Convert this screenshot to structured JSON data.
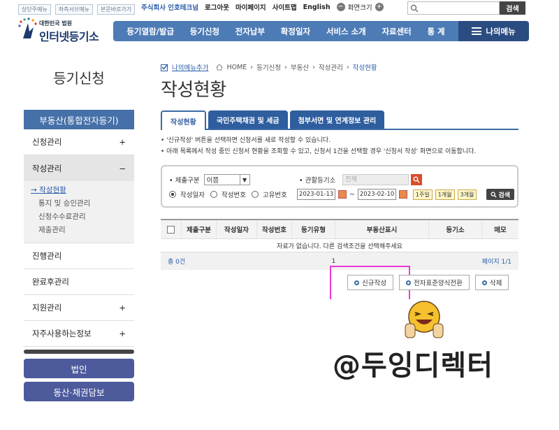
{
  "util": {
    "links": [
      "상단주메뉴",
      "좌측서브메뉴",
      "본문바로가기"
    ],
    "company": "주식회사 인호테크넘",
    "logout": "로그아웃",
    "mypage": "마이페이지",
    "sitemap": "사이트맵",
    "english": "English",
    "zoom_label": "화면크기",
    "zoom_out": "−",
    "zoom_in": "+",
    "search_button": "검색",
    "search_value": ""
  },
  "logo": {
    "subtitle": "대한민국 법원",
    "title": "인터넷등기소"
  },
  "nav": {
    "items": [
      "등기열람/발급",
      "등기신청",
      "전자납부",
      "확정일자",
      "서비스 소개",
      "자료센터",
      "통 계"
    ],
    "my_menu": "나의메뉴"
  },
  "sidebar": {
    "title": "등기신청",
    "head": "부동산(통합전자등기)",
    "items": [
      {
        "label": "신청관리",
        "toggle": "+"
      },
      {
        "label": "작성관리",
        "toggle": "−"
      },
      {
        "label": "진행관리",
        "toggle": ""
      },
      {
        "label": "완료후관리",
        "toggle": ""
      },
      {
        "label": "지원관리",
        "toggle": "+"
      },
      {
        "label": "자주사용하는정보",
        "toggle": "+"
      }
    ],
    "sub_items": [
      "→ 작성현황",
      "통지 및 승인관리",
      "신청수수료관리",
      "제출관리"
    ],
    "buttons": [
      "법인",
      "동산·채권담보"
    ]
  },
  "breadcrumb": {
    "favorite": "나의메뉴추가",
    "home": "HOME",
    "path": [
      "등기신청",
      "부동산",
      "작성관리"
    ],
    "current": "작성현황"
  },
  "page_title": "작성현황",
  "tabs": [
    "작성현황",
    "국민주택채권 및 세금",
    "첨부서면 및 연계정보 관리"
  ],
  "notes": [
    "• '신규작성' 버튼을 선택하면 신청서를 새로 작성할 수 있습니다.",
    "• 아래 목록에서 작성 중인 신청서 현황을 조회할 수 있고, 신청서 1건을 선택할 경우 '신청서 작성' 화면으로 이동합니다."
  ],
  "filter": {
    "type_label": "• 제출구분",
    "type_value": "이쯤",
    "court_label": "• 관할등기소",
    "court_value": "전체",
    "radios": [
      "작성일자",
      "작성번호",
      "고유번호"
    ],
    "date_from": "2023-01-13",
    "date_sep": "~",
    "date_to": "2023-02-10",
    "quick": [
      "1주일",
      "1개월",
      "3개월"
    ],
    "search_label": "검색"
  },
  "table": {
    "headers": [
      "제출구분",
      "작성일자",
      "작성번호",
      "등기유형",
      "부동산표시",
      "등기소",
      "메모"
    ],
    "empty_message": "자료가 없습니다. 다른 검색조건을 선택해주세요",
    "total": "총 0건",
    "page_center": "1",
    "page_info": "페이지 1/1"
  },
  "actions": [
    "신규작성",
    "전자표준양식전환",
    "삭제"
  ],
  "watermark": "@두잉디렉터",
  "colors": {
    "nav_blue": "#4d7bb5",
    "sidebar_head": "#4670a8",
    "highlight": "#ea3bd9"
  }
}
